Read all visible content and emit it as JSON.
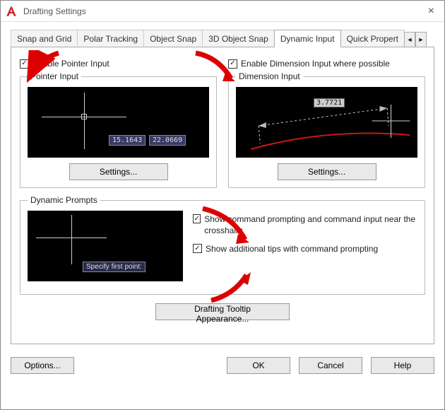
{
  "window": {
    "title": "Drafting Settings"
  },
  "tabs": {
    "items": [
      {
        "label": "Snap and Grid"
      },
      {
        "label": "Polar Tracking"
      },
      {
        "label": "Object Snap"
      },
      {
        "label": "3D Object Snap"
      },
      {
        "label": "Dynamic Input"
      },
      {
        "label": "Quick Propert"
      }
    ],
    "active_index": 4
  },
  "dynamic_input": {
    "enable_pointer": "Enable Pointer Input",
    "enable_dimension": "Enable Dimension Input where possible",
    "pointer_group": "Pointer Input",
    "dimension_group": "Dimension Input",
    "prompts_group": "Dynamic Prompts",
    "settings_btn": "Settings...",
    "pointer_preview": {
      "coord_x": "15.1643",
      "coord_y": "22.0669"
    },
    "dimension_preview": {
      "value": "3.7721"
    },
    "prompts_preview": {
      "text": "Specify first point:"
    },
    "show_cmd_prompting": "Show command prompting and command input near the crosshairs",
    "show_additional_tips": "Show additional tips with command prompting",
    "tooltip_appearance": "Drafting Tooltip Appearance..."
  },
  "footer": {
    "options": "Options...",
    "ok": "OK",
    "cancel": "Cancel",
    "help": "Help"
  }
}
